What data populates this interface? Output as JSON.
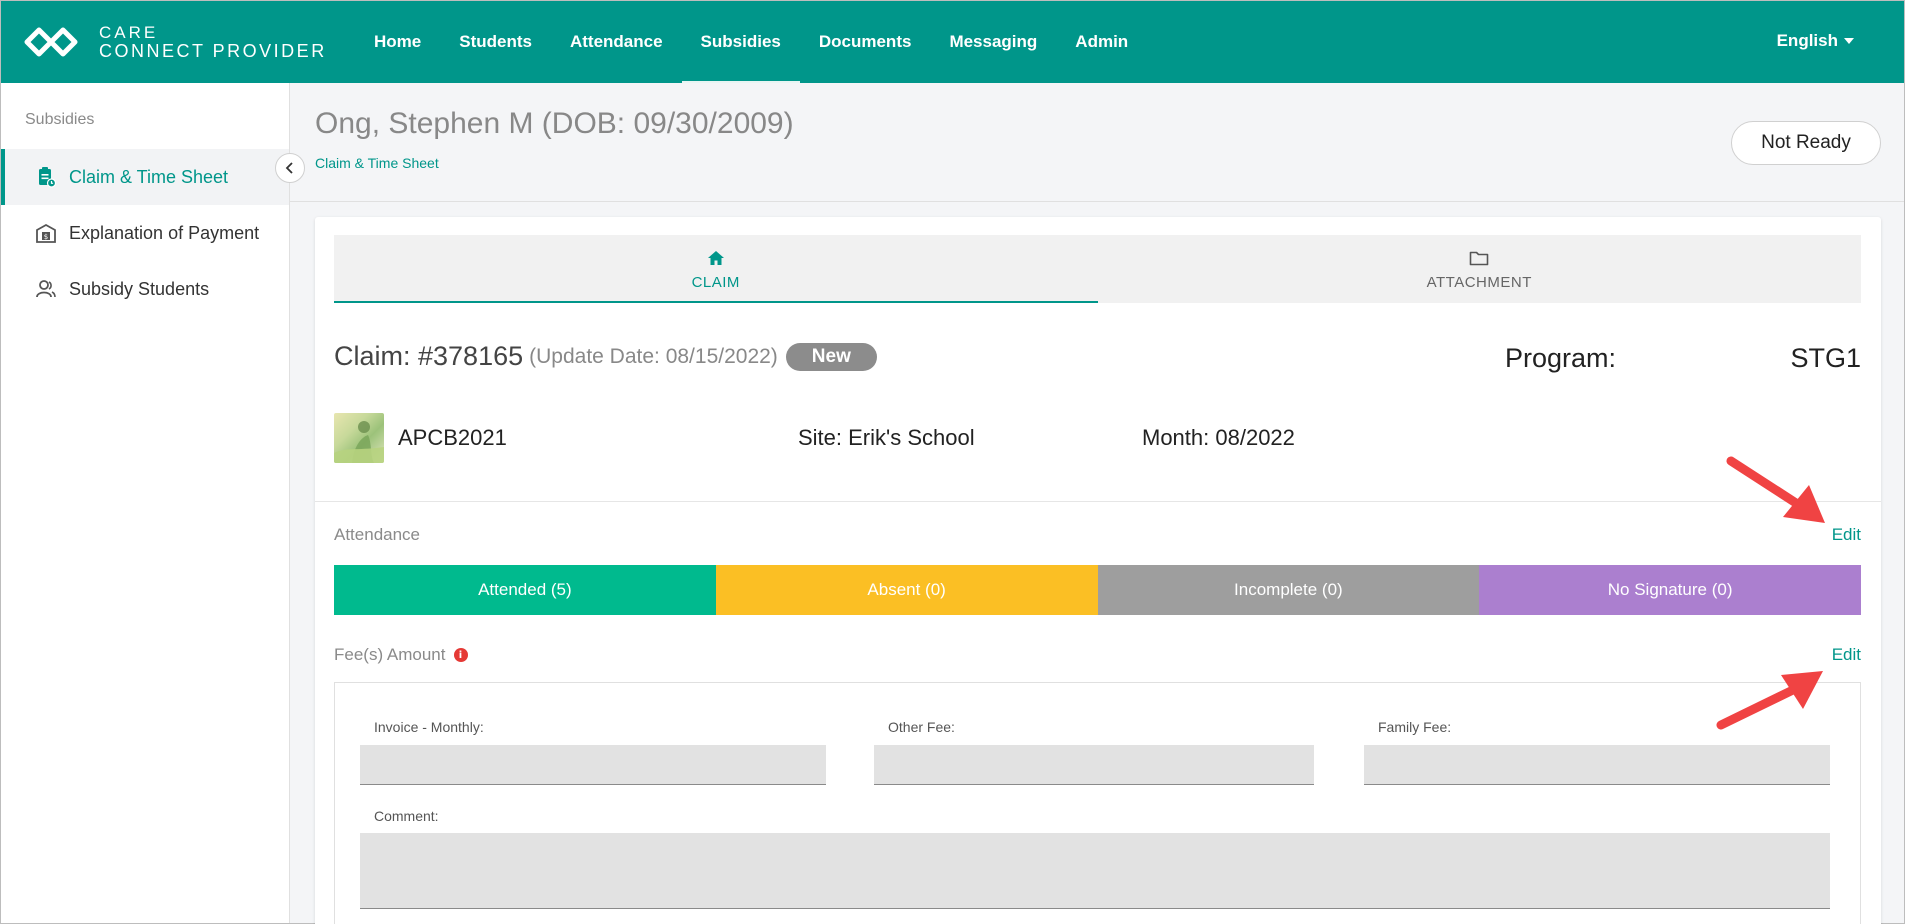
{
  "app": {
    "logo_line1": "CARE",
    "logo_line2": "CONNECT PROVIDER"
  },
  "nav": {
    "items": [
      "Home",
      "Students",
      "Attendance",
      "Subsidies",
      "Documents",
      "Messaging",
      "Admin"
    ],
    "active": "Subsidies",
    "language": "English"
  },
  "sidebar": {
    "title": "Subsidies",
    "items": [
      {
        "label": "Claim & Time Sheet",
        "icon": "clipboard-icon",
        "active": true
      },
      {
        "label": "Explanation of Payment",
        "icon": "building-money-icon",
        "active": false
      },
      {
        "label": "Subsidy Students",
        "icon": "users-icon",
        "active": false
      }
    ]
  },
  "header": {
    "title": "Ong, Stephen M (DOB: 09/30/2009)",
    "breadcrumb": "Claim & Time Sheet",
    "status_button": "Not Ready"
  },
  "tabs": [
    {
      "label": "CLAIM",
      "icon": "home-icon",
      "active": true
    },
    {
      "label": "ATTACHMENT",
      "icon": "folder-icon",
      "active": false
    }
  ],
  "claim": {
    "number": "Claim: #378165",
    "update_date": "(Update Date: 08/15/2022)",
    "badge": "New",
    "program_label": "Program:",
    "program_value": "STG1",
    "student_code": "APCB2021",
    "site": "Site: Erik's School",
    "month": "Month: 08/2022"
  },
  "attendance": {
    "label": "Attendance",
    "edit": "Edit",
    "segments": [
      {
        "label": "Attended (5)",
        "color": "#00ba8e"
      },
      {
        "label": "Absent (0)",
        "color": "#fbbf24"
      },
      {
        "label": "Incomplete (0)",
        "color": "#9e9e9e"
      },
      {
        "label": "No Signature (0)",
        "color": "#ab7fcf"
      }
    ]
  },
  "fees": {
    "label": "Fee(s) Amount",
    "info_mark": "i",
    "edit": "Edit",
    "invoice_label": "Invoice - Monthly:",
    "invoice_value": "",
    "other_label": "Other Fee:",
    "other_value": "",
    "family_label": "Family Fee:",
    "family_value": "",
    "comment_label": "Comment:",
    "comment_value": ""
  },
  "colors": {
    "brand": "#00968a",
    "annotation_arrow": "#f04343"
  }
}
